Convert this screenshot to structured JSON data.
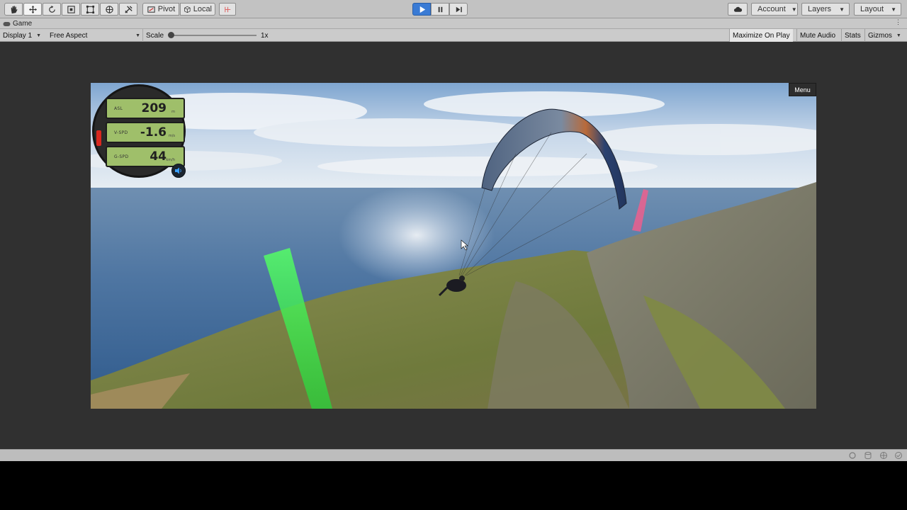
{
  "toolbar": {
    "tools": [
      {
        "name": "hand-tool",
        "icon": "hand-icon"
      },
      {
        "name": "move-tool",
        "icon": "move-icon"
      },
      {
        "name": "rotate-tool",
        "icon": "rotate-icon"
      },
      {
        "name": "scale-tool",
        "icon": "scale-icon"
      },
      {
        "name": "rect-tool",
        "icon": "rect-transform-icon"
      },
      {
        "name": "transform-tool",
        "icon": "transform-icon"
      },
      {
        "name": "custom-tool",
        "icon": "custom-tools-icon"
      }
    ],
    "pivot_label": "Pivot",
    "local_label": "Local",
    "account_label": "Account",
    "layers_label": "Layers",
    "layout_label": "Layout"
  },
  "tab": {
    "title": "Game"
  },
  "game_controls": {
    "display": "Display 1",
    "aspect": "Free Aspect",
    "scale_label": "Scale",
    "scale_value": "1x",
    "maximize_on_play": "Maximize On Play",
    "mute_audio": "Mute Audio",
    "stats": "Stats",
    "gizmos": "Gizmos"
  },
  "hud": {
    "asl_label": "ASL",
    "asl_value": "209",
    "asl_unit": "m",
    "vspd_label": "V-SPD",
    "vspd_value": "-1.6",
    "vspd_unit": "m/s",
    "gspd_label": "G-SPD",
    "gspd_value": "44",
    "gspd_unit": "km/h"
  },
  "menu_button": "Menu",
  "colors": {
    "play_accent": "#3a7bd5",
    "hud_lcd": "#9fbf6a",
    "vario_red": "#d8281f",
    "thermal_green": "#39e84a",
    "marker_pink": "#ff5a8a"
  }
}
